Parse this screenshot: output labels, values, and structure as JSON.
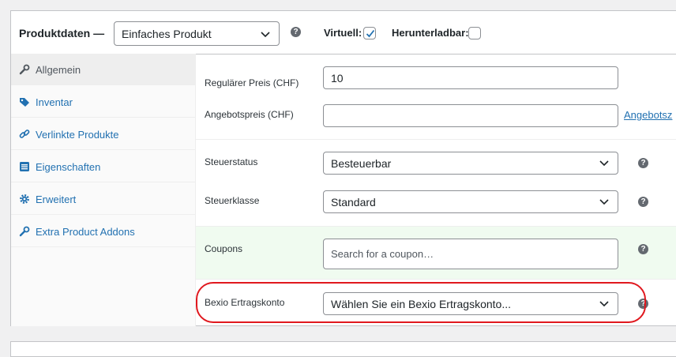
{
  "header": {
    "title": "Produktdaten —",
    "product_type": "Einfaches Produkt",
    "virtual_label": "Virtuell:",
    "virtual_checked": true,
    "downloadable_label": "Herunterladbar:",
    "downloadable_checked": false
  },
  "sidebar": {
    "items": [
      {
        "label": "Allgemein",
        "icon": "wrench-icon",
        "active": true
      },
      {
        "label": "Inventar",
        "icon": "tag-icon",
        "active": false
      },
      {
        "label": "Verlinkte Produkte",
        "icon": "link-icon",
        "active": false
      },
      {
        "label": "Eigenschaften",
        "icon": "list-icon",
        "active": false
      },
      {
        "label": "Erweitert",
        "icon": "gear-icon",
        "active": false
      },
      {
        "label": "Extra Product Addons",
        "icon": "wrench-icon",
        "active": false
      }
    ]
  },
  "fields": {
    "regular_price": {
      "label": "Regulärer Preis (CHF)",
      "value": "10"
    },
    "sale_price": {
      "label": "Angebotspreis (CHF)",
      "value": "",
      "link": "Angebotsz"
    },
    "tax_status": {
      "label": "Steuerstatus",
      "value": "Besteuerbar"
    },
    "tax_class": {
      "label": "Steuerklasse",
      "value": "Standard"
    },
    "coupons": {
      "label": "Coupons",
      "placeholder": "Search for a coupon…"
    },
    "bexio": {
      "label": "Bexio Ertragskonto",
      "value": "Wählen Sie ein Bexio Ertragskonto..."
    }
  },
  "colors": {
    "accent": "#2271b1",
    "highlight": "#e0181e",
    "coupon_bg": "#f0fbf0"
  }
}
